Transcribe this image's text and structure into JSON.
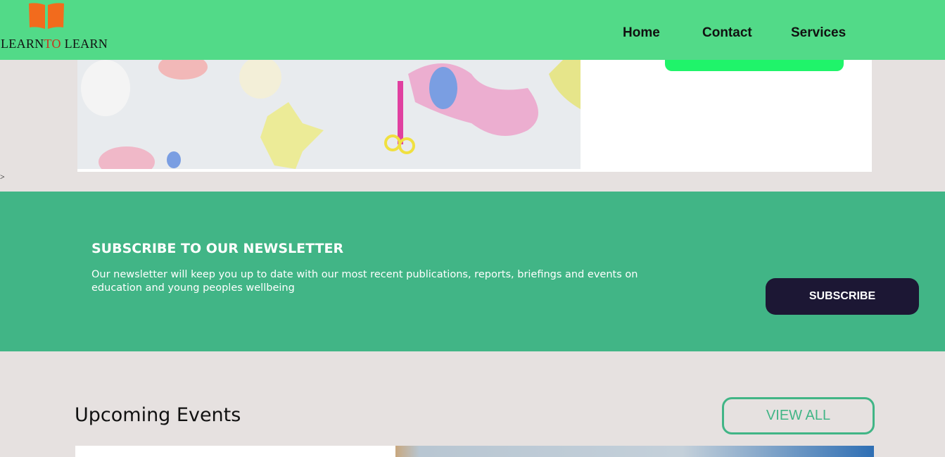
{
  "header": {
    "logo": {
      "part1": "LEARN",
      "part2": "TO",
      "part3": " LEARN"
    },
    "nav": [
      "Home",
      "Contact",
      "Services"
    ]
  },
  "stray_text": ">",
  "newsletter": {
    "title": "SUBSCRIBE TO OUR NEWSLETTER",
    "description": "Our newsletter will keep you up to date with our most recent publications, reports, briefings and events on education and young peoples wellbeing",
    "button": "SUBSCRIBE"
  },
  "events": {
    "title": "Upcoming Events",
    "view_all": "VIEW ALL"
  },
  "colors": {
    "header": "#52da88",
    "newsletter_bg": "#41b586",
    "subscribe_btn": "#1c1734",
    "logo_book": "#f26b1d"
  }
}
